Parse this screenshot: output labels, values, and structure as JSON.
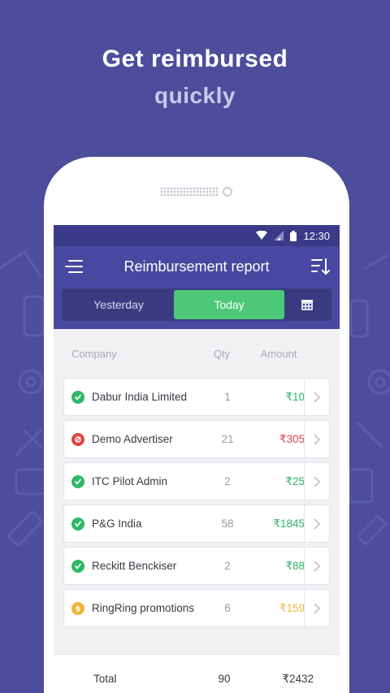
{
  "promo": {
    "headline": "Get reimbursed",
    "subline": "quickly"
  },
  "statusbar": {
    "time": "12:30"
  },
  "appbar": {
    "title": "Reimbursement report"
  },
  "tabs": [
    {
      "label": "Yesterday",
      "active": false
    },
    {
      "label": "Today",
      "active": true
    }
  ],
  "table": {
    "headers": {
      "company": "Company",
      "qty": "Qty",
      "amount": "Amount"
    },
    "rows": [
      {
        "company": "Dabur India Limited",
        "qty": "1",
        "amount": "₹10",
        "status": "approved"
      },
      {
        "company": "Demo Advertiser",
        "qty": "21",
        "amount": "₹305",
        "status": "rejected"
      },
      {
        "company": "ITC Pilot Admin",
        "qty": "2",
        "amount": "₹25",
        "status": "approved"
      },
      {
        "company": "P&G India",
        "qty": "58",
        "amount": "₹1845",
        "status": "approved"
      },
      {
        "company": "Reckitt Benckiser",
        "qty": "2",
        "amount": "₹88",
        "status": "approved"
      },
      {
        "company": "RingRing promotions",
        "qty": "6",
        "amount": "₹159",
        "status": "pending"
      }
    ]
  },
  "footer": {
    "label": "Total",
    "qty": "90",
    "amount": "₹2432"
  },
  "colors": {
    "background": "#4d4d9c",
    "appbar": "#4848a0",
    "active_tab": "#4cc878",
    "approved": "#2db866",
    "rejected": "#e04545",
    "pending": "#f0b63c"
  }
}
